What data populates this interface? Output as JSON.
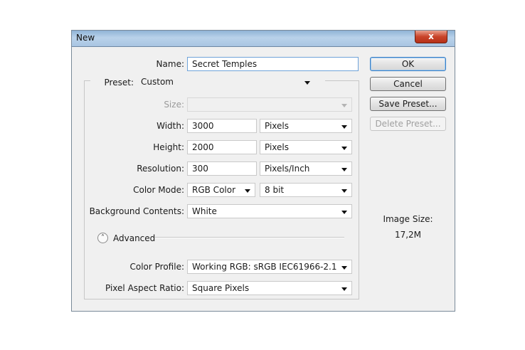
{
  "window": {
    "title": "New",
    "close_glyph": "x"
  },
  "form": {
    "name": {
      "label": "Name:",
      "value": "Secret Temples"
    },
    "preset": {
      "label": "Preset:",
      "value": "Custom"
    },
    "size": {
      "label": "Size:",
      "value": ""
    },
    "width": {
      "label": "Width:",
      "value": "3000",
      "unit": "Pixels"
    },
    "height": {
      "label": "Height:",
      "value": "2000",
      "unit": "Pixels"
    },
    "resolution": {
      "label": "Resolution:",
      "value": "300",
      "unit": "Pixels/Inch"
    },
    "color_mode": {
      "label": "Color Mode:",
      "value": "RGB Color",
      "depth": "8 bit"
    },
    "background": {
      "label": "Background Contents:",
      "value": "White"
    },
    "advanced": {
      "label": "Advanced",
      "toggle_glyph": "˄"
    },
    "color_profile": {
      "label": "Color Profile:",
      "value": "Working RGB:  sRGB IEC61966-2.1"
    },
    "pixel_aspect": {
      "label": "Pixel Aspect Ratio:",
      "value": "Square Pixels"
    }
  },
  "buttons": {
    "ok": "OK",
    "cancel": "Cancel",
    "save_preset": "Save Preset...",
    "delete_preset": "Delete Preset..."
  },
  "info": {
    "image_size_label": "Image Size:",
    "image_size_value": "17,2M"
  },
  "icons": {
    "dropdown": "chevron-down-icon",
    "collapse": "chevron-up-icon"
  }
}
